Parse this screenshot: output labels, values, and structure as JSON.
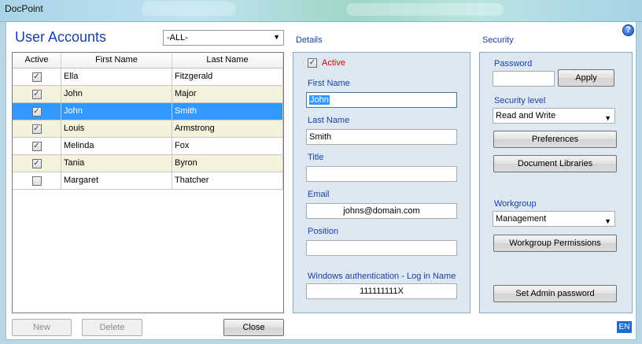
{
  "window": {
    "title": "DocPoint"
  },
  "accounts": {
    "heading": "User Accounts",
    "filter_value": "-ALL-",
    "columns": [
      "Active",
      "First Name",
      "Last Name"
    ],
    "rows": [
      {
        "active": true,
        "first": "Ella",
        "last": "Fitzgerald"
      },
      {
        "active": true,
        "first": "John",
        "last": "Major"
      },
      {
        "active": true,
        "first": "John",
        "last": "Smith"
      },
      {
        "active": true,
        "first": "Louis",
        "last": "Armstrong"
      },
      {
        "active": true,
        "first": "Melinda",
        "last": "Fox"
      },
      {
        "active": true,
        "first": "Tania",
        "last": "Byron"
      },
      {
        "active": false,
        "first": "Margaret",
        "last": "Thatcher"
      }
    ],
    "selected_row": 2
  },
  "buttons": {
    "new": "New",
    "delete": "Delete",
    "close": "Close"
  },
  "details": {
    "caption": "Details",
    "active_label": "Active",
    "first_name_label": "First Name",
    "first_name_value": "John",
    "last_name_label": "Last Name",
    "last_name_value": "Smith",
    "title_label": "Title",
    "title_value": "",
    "email_label": "Email",
    "email_value": "johns@domain.com",
    "position_label": "Position",
    "position_value": "",
    "windows_auth_label": "Windows authentication - Log in Name",
    "windows_auth_value": "111111111X"
  },
  "security": {
    "caption": "Security",
    "password_label": "Password",
    "password_value": "",
    "apply_label": "Apply",
    "security_level_label": "Security level",
    "security_level_value": "Read and Write",
    "preferences_label": "Preferences",
    "doc_libraries_label": "Document Libraries",
    "workgroup_label": "Workgroup",
    "workgroup_value": "Management",
    "workgroup_permissions_label": "Workgroup Permissions",
    "admin_password_label": "Set Admin password"
  },
  "status": {
    "language": "EN",
    "help": "?"
  },
  "colors": {
    "accent_text": "#1b3fa8",
    "selected_row": "#3399ff",
    "panel": "#dde8f3",
    "active_label": "#e00000"
  }
}
